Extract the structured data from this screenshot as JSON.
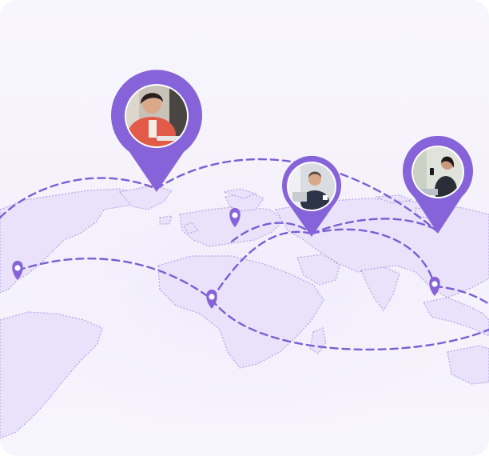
{
  "colors": {
    "accent": "#8763d9",
    "route": "#7b5fd3",
    "land": "#e9e2fa",
    "land_border": "#b6a4e6",
    "background": "#f5f2fc"
  },
  "map": {
    "icon": "world-map"
  },
  "avatars": [
    {
      "icon": "person-woman-red-blazer-laptop-photo"
    },
    {
      "icon": "person-man-suit-laptop-photo"
    },
    {
      "icon": "person-woman-phone-photo"
    }
  ],
  "small_pins": [
    {
      "icon": "map-pin-icon"
    },
    {
      "icon": "map-pin-icon"
    },
    {
      "icon": "map-pin-icon"
    },
    {
      "icon": "map-pin-icon"
    }
  ]
}
